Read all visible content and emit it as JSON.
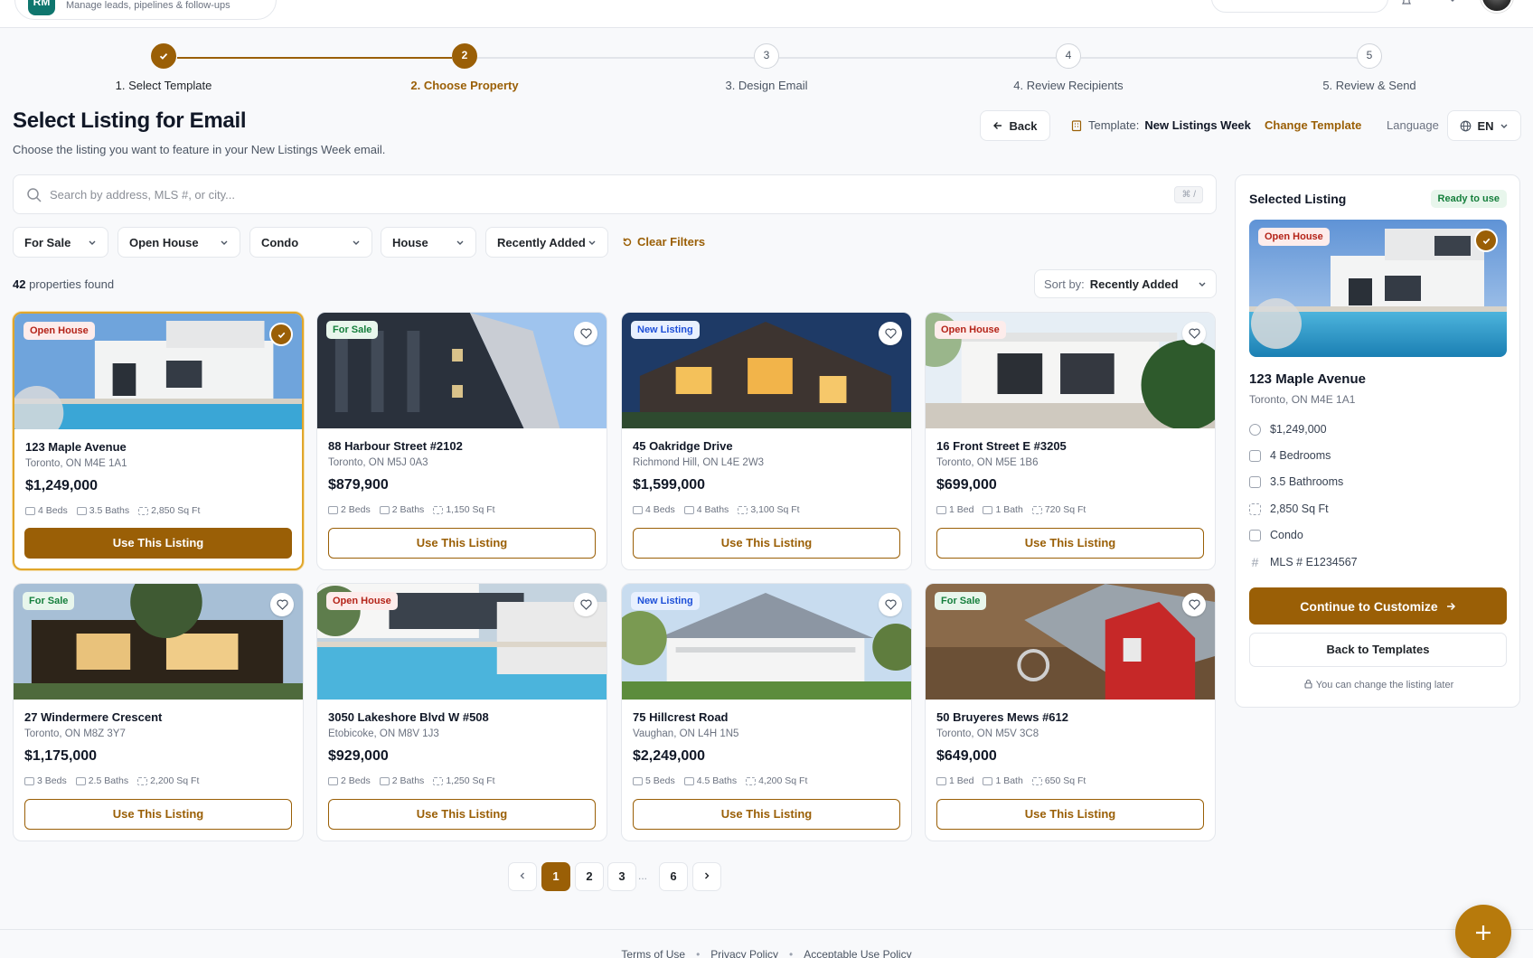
{
  "app": {
    "subtitle": "Manage leads, pipelines & follow-ups",
    "logo_text": "RM"
  },
  "stepper": {
    "steps": [
      {
        "num": "1",
        "label": "1. Select Template",
        "state": "done"
      },
      {
        "num": "2",
        "label": "2. Choose Property",
        "state": "active"
      },
      {
        "num": "3",
        "label": "3. Design Email",
        "state": "todo"
      },
      {
        "num": "4",
        "label": "4. Review Recipients",
        "state": "todo"
      },
      {
        "num": "5",
        "label": "5. Review & Send",
        "state": "todo"
      }
    ]
  },
  "header": {
    "title": "Select Listing for Email",
    "subtitle": "Choose the listing you want to feature in your New Listings Week email.",
    "back_label": "Back",
    "template_prefix": "Template:",
    "template_name": "New Listings Week",
    "change_template_label": "Change Template",
    "language_label": "Language",
    "language_value": "EN"
  },
  "search": {
    "placeholder": "Search by address, MLS #, or city...",
    "value": "",
    "shortcut": "⌘ /"
  },
  "filters": {
    "items": [
      "For Sale",
      "Open House",
      "Condo",
      "House",
      "Recently Added"
    ],
    "clear_label": "Clear Filters"
  },
  "results": {
    "count": "42",
    "suffix": "properties found"
  },
  "sort": {
    "label": "Sort by:",
    "value": "Recently Added"
  },
  "listings": [
    {
      "badge": "Open House",
      "badge_type": "oh",
      "title": "123 Maple Avenue",
      "address": "Toronto, ON M4E 1A1",
      "price": "$1,249,000",
      "beds": "4 Beds",
      "baths": "3.5 Baths",
      "sqft": "2,850 Sq Ft",
      "button": "Use This Listing",
      "selected": true
    },
    {
      "badge": "For Sale",
      "badge_type": "fs",
      "title": "88 Harbour Street #2102",
      "address": "Toronto, ON M5J 0A3",
      "price": "$879,900",
      "beds": "2 Beds",
      "baths": "2 Baths",
      "sqft": "1,150 Sq Ft",
      "button": "Use This Listing",
      "selected": false
    },
    {
      "badge": "New Listing",
      "badge_type": "nl",
      "title": "45 Oakridge Drive",
      "address": "Richmond Hill, ON L4E 2W3",
      "price": "$1,599,000",
      "beds": "4 Beds",
      "baths": "4 Baths",
      "sqft": "3,100 Sq Ft",
      "button": "Use This Listing",
      "selected": false
    },
    {
      "badge": "Open House",
      "badge_type": "oh",
      "title": "16 Front Street E #3205",
      "address": "Toronto, ON M5E 1B6",
      "price": "$699,000",
      "beds": "1 Bed",
      "baths": "1 Bath",
      "sqft": "720 Sq Ft",
      "button": "Use This Listing",
      "selected": false
    },
    {
      "badge": "For Sale",
      "badge_type": "fs",
      "title": "27 Windermere Crescent",
      "address": "Toronto, ON M8Z 3Y7",
      "price": "$1,175,000",
      "beds": "3 Beds",
      "baths": "2.5 Baths",
      "sqft": "2,200 Sq Ft",
      "button": "Use This Listing",
      "selected": false
    },
    {
      "badge": "Open House",
      "badge_type": "oh",
      "title": "3050 Lakeshore Blvd W #508",
      "address": "Etobicoke, ON M8V 1J3",
      "price": "$929,000",
      "beds": "2 Beds",
      "baths": "2 Baths",
      "sqft": "1,250 Sq Ft",
      "button": "Use This Listing",
      "selected": false
    },
    {
      "badge": "New Listing",
      "badge_type": "nl",
      "title": "75 Hillcrest Road",
      "address": "Vaughan, ON L4H 1N5",
      "price": "$2,249,000",
      "beds": "5 Beds",
      "baths": "4.5 Baths",
      "sqft": "4,200 Sq Ft",
      "button": "Use This Listing",
      "selected": false
    },
    {
      "badge": "For Sale",
      "badge_type": "fs",
      "title": "50 Bruyeres Mews #612",
      "address": "Toronto, ON M5V 3C8",
      "price": "$649,000",
      "beds": "1 Bed",
      "baths": "1 Bath",
      "sqft": "650 Sq Ft",
      "button": "Use This Listing",
      "selected": false
    }
  ],
  "pagination": {
    "pages": [
      "1",
      "2",
      "3"
    ],
    "ellipsis": "...",
    "last": "6",
    "current": "1"
  },
  "selected": {
    "heading": "Selected Listing",
    "status": "Ready to use",
    "badge": "Open House",
    "title": "123 Maple Avenue",
    "address": "Toronto, ON M4E 1A1",
    "price": "$1,249,000",
    "bedrooms": "4 Bedrooms",
    "bathrooms": "3.5 Bathrooms",
    "sqft": "2,850 Sq Ft",
    "type": "Condo",
    "mls": "MLS # E1234567",
    "continue_label": "Continue to Customize",
    "back_label": "Back to Templates",
    "note": "You can change the listing later"
  },
  "footer": {
    "links": [
      "Terms of Use",
      "Privacy Policy",
      "Acceptable Use Policy"
    ]
  },
  "colors": {
    "brand": "#9a5f06",
    "open_house": "#b42318",
    "for_sale": "#157f3c",
    "new_listing": "#1d4fd8"
  }
}
